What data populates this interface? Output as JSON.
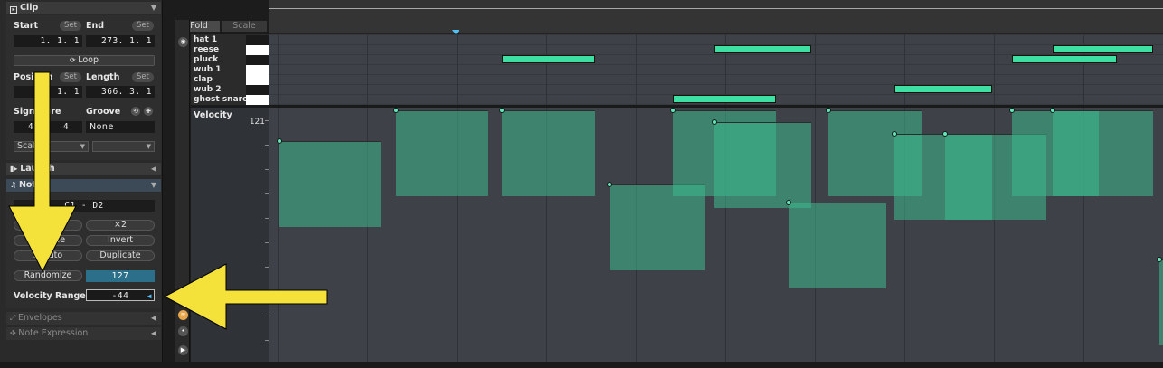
{
  "clip": {
    "header": "Clip",
    "start_label": "Start",
    "end_label": "End",
    "set_label": "Set",
    "start_value": "1.   1.   1",
    "end_value": "273.   1.   1",
    "loop_label": "Loop",
    "position_label": "Position",
    "length_label": "Length",
    "position_value": "1.   1.   1",
    "length_value": "366.   3.   1",
    "signature_label": "Signature",
    "groove_label": "Groove",
    "sig_num": "4",
    "sig_den": "4",
    "groove_value": "None",
    "scale_label": "Scale"
  },
  "launch": {
    "header": "Launch"
  },
  "notes": {
    "header": "Notes",
    "range_value": "C1 - D2",
    "half_label": "÷2",
    "double_label": "×2",
    "reverse_label": "Reverse",
    "invert_label": "Invert",
    "legato_label": "Legato",
    "duplicate_label": "Duplicate",
    "randomize_label": "Randomize",
    "randomize_value": "127",
    "velocity_range_label": "Velocity Range",
    "velocity_range_value": "-44"
  },
  "envelopes": {
    "header": "Envelopes"
  },
  "note_expression": {
    "header": "Note Expression"
  },
  "editor": {
    "fold_label": "Fold",
    "scale_label": "Scale",
    "velocity_label": "Velocity",
    "velocity_max": "121",
    "lanes": [
      {
        "name": "hat 1",
        "color": "#1a1a1a"
      },
      {
        "name": "reese",
        "color": "#ffffff"
      },
      {
        "name": "pluck",
        "color": "#1a1a1a"
      },
      {
        "name": "wub 1",
        "color": "#ffffff"
      },
      {
        "name": "clap",
        "color": "#ffffff"
      },
      {
        "name": "wub 2",
        "color": "#1a1a1a"
      },
      {
        "name": "ghost snare",
        "color": "#ffffff"
      }
    ]
  },
  "colors": {
    "note": "#3de0a2",
    "velocity_bar": "#3db98c",
    "accent_blue": "#2b6f8a",
    "annotation_arrow": "#f4e23a"
  }
}
